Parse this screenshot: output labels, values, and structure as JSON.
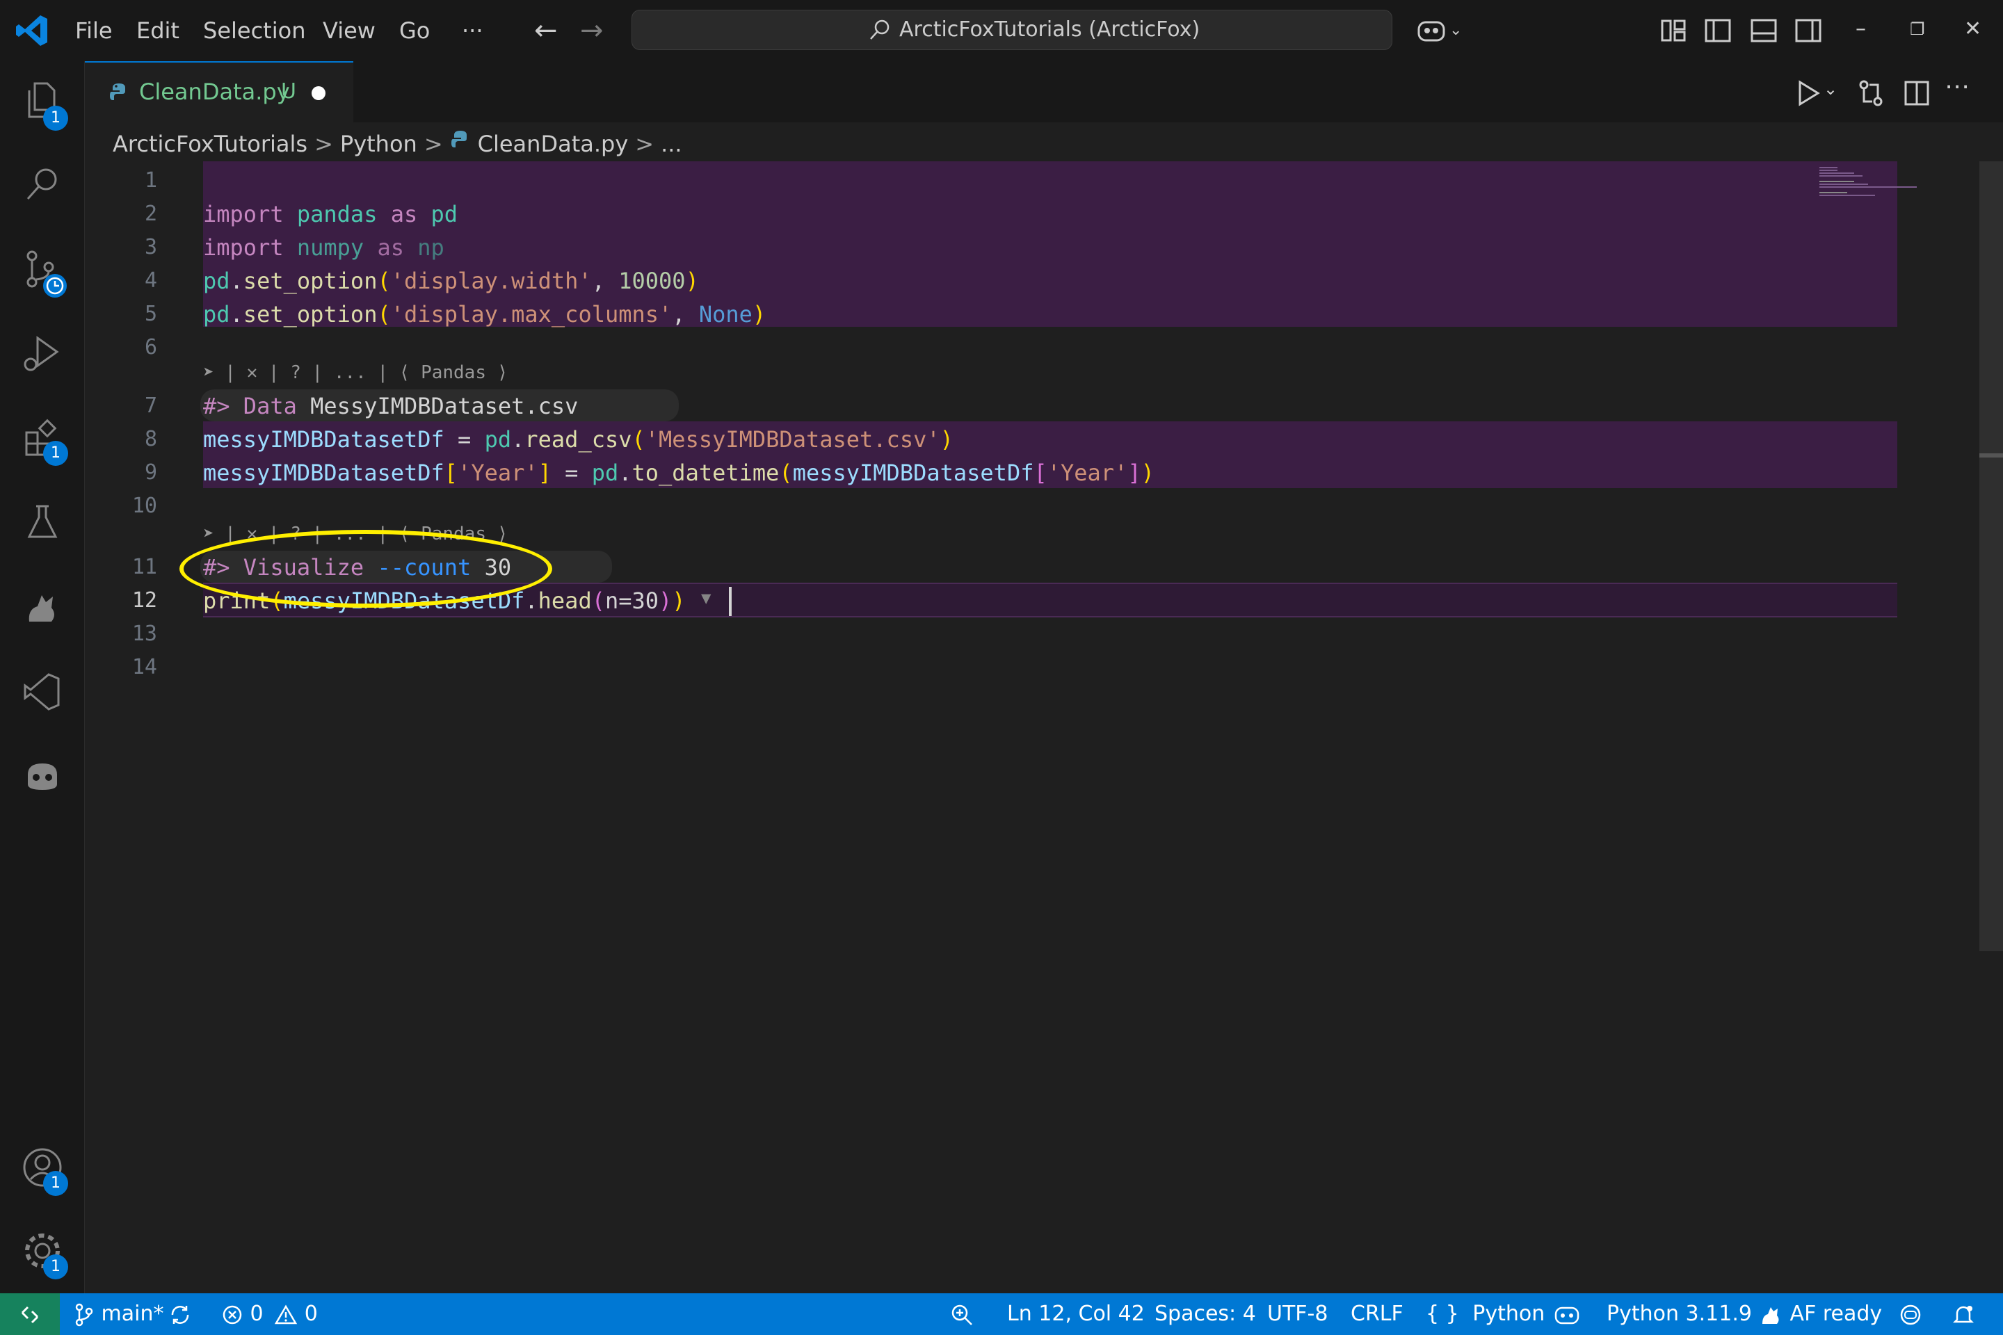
{
  "titlebar": {
    "menu": [
      "File",
      "Edit",
      "Selection",
      "View",
      "Go"
    ],
    "more": "···",
    "command_center": "ArcticFoxTutorials (ArcticFox)",
    "window_controls": {
      "minimize": "–",
      "restore": "❐",
      "close": "✕"
    }
  },
  "activitybar": {
    "items": [
      "explorer-icon",
      "search-icon",
      "source-control-icon",
      "run-debug-icon",
      "extensions-icon",
      "testing-icon",
      "arcticfox-icon",
      "visual-studio-icon",
      "copilot-icon"
    ],
    "badges": {
      "explorer": "1",
      "extensions": "1",
      "accounts": "1",
      "settings": "1"
    }
  },
  "tab": {
    "label": "CleanData.py",
    "status": "U"
  },
  "breadcrumb": {
    "items": [
      "ArcticFoxTutorials",
      "Python",
      "CleanData.py",
      "..."
    ],
    "separator": ">"
  },
  "editor": {
    "line_numbers": [
      "1",
      "2",
      "3",
      "4",
      "5",
      "6",
      "7",
      "8",
      "9",
      "10",
      "11",
      "12",
      "13",
      "14"
    ],
    "codelens_1": "➤ | ✕ | ? | ... | ⟨ Pandas ⟩",
    "codelens_2": "➤ | ✕ | ? | ... | ⟨ Pandas ⟩",
    "lines": {
      "l2": [
        "import",
        " ",
        "pandas",
        " ",
        "as",
        " ",
        "pd"
      ],
      "l3": [
        "import",
        " ",
        "numpy",
        " ",
        "as",
        " ",
        "np"
      ],
      "l4": [
        "pd",
        ".",
        "set_option",
        "(",
        "'display.width'",
        ", ",
        "10000",
        ")"
      ],
      "l5": [
        "pd",
        ".",
        "set_option",
        "(",
        "'display.max_columns'",
        ", ",
        "None",
        ")"
      ],
      "l7": [
        "#>",
        " ",
        "Data",
        " ",
        "MessyIMDBDataset.csv"
      ],
      "l8": [
        "messyIMDBDatasetDf",
        " = ",
        "pd",
        ".",
        "read_csv",
        "(",
        "'MessyIMDBDataset.csv'",
        ")"
      ],
      "l9": [
        "messyIMDBDatasetDf",
        "[",
        "'Year'",
        "]",
        " = ",
        "pd",
        ".",
        "to_datetime",
        "(",
        "messyIMDBDatasetDf",
        "[",
        "'Year'",
        "]",
        ")"
      ],
      "l11": [
        "#>",
        " ",
        "Visualize",
        " ",
        "--count",
        " ",
        "30"
      ],
      "l12": [
        "print",
        "(",
        "messyIMDBDatasetDf",
        ".",
        "head",
        "(",
        "n=30",
        ")",
        ")"
      ]
    },
    "fold_marker": "▼"
  },
  "statusbar": {
    "branch": "main*",
    "errors": "0",
    "warnings": "0",
    "cursor_pos": "Ln 12, Col 42",
    "spaces": "Spaces: 4",
    "encoding": "UTF-8",
    "eol": "CRLF",
    "language": "Python",
    "interpreter": "Python 3.11.9",
    "af_status": "AF ready",
    "language_braces": "{ }"
  },
  "colors": {
    "accent": "#0078d4",
    "cell_highlight": "#3b1e44",
    "annotation": "#ffef00",
    "untracked": "#73c991"
  }
}
